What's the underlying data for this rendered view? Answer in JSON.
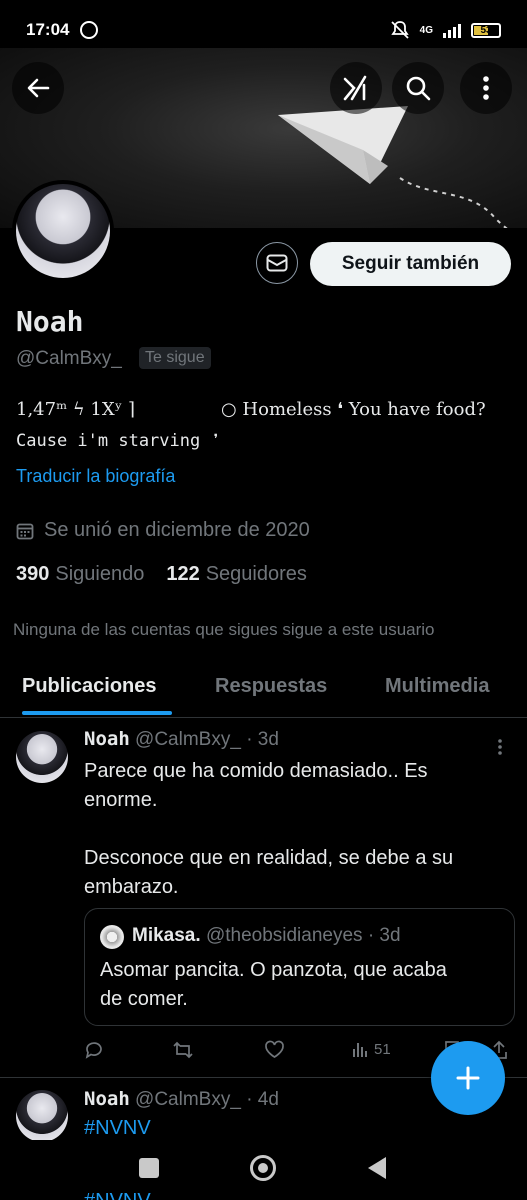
{
  "status_bar": {
    "time": "17:04",
    "network": "4G",
    "battery": "53"
  },
  "profile": {
    "name": "Noah",
    "handle": "@CalmBxy_",
    "follows_you_badge": "Te sigue",
    "follow_button": "Seguir también",
    "bio_line1_a": "1,47ᵐ ϟ 1Xʸ ⌉",
    "bio_line1_b": "○ Homeless ❛ You have food?",
    "bio_line2": "Cause i'm starving ❜",
    "translate_link": "Traducir la biografía",
    "joined": "Se unió en diciembre de 2020",
    "following_count": "390",
    "following_label": "Siguiendo",
    "followers_count": "122",
    "followers_label": "Seguidores",
    "no_mutuals": "Ninguna de las cuentas que sigues sigue a este usuario"
  },
  "tabs": [
    "Publicaciones",
    "Respuestas",
    "Multimedia"
  ],
  "tweets": [
    {
      "name": "Noah",
      "handle_time": "@CalmBxy_ · 3d",
      "text_line1": "Parece que ha comido demasiado.. Es",
      "text_line2": "enorme.",
      "text_line3": "Desconoce que en realidad, se debe a su",
      "text_line4": "embarazo.",
      "quote": {
        "name": "Mikasa.",
        "handle_time": "@theobsidianeyes · 3d",
        "text_line1": "Asomar pancita. O panzota, que acaba",
        "text_line2": "de comer."
      },
      "views": "51"
    },
    {
      "name": "Noah",
      "handle_time": "@CalmBxy_ · 4d",
      "text_line1": "#NVNV"
    }
  ],
  "peek_text": "#NVNV",
  "colors": {
    "accent": "#1d9bf0",
    "background": "#000000",
    "text_primary": "#e7e9ea",
    "text_secondary": "#71767b"
  }
}
